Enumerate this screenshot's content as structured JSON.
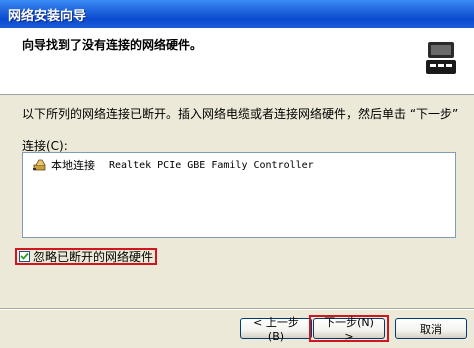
{
  "window": {
    "title": "网络安装向导"
  },
  "header": {
    "heading": "向导找到了没有连接的网络硬件。",
    "icon": "wizard-network-icon"
  },
  "body": {
    "instruction": "以下所列的网络连接已断开。插入网络电缆或者连接网络硬件，然后单击 “下一步”",
    "connections_label": "连接(C):",
    "connections": [
      {
        "name": "本地连接",
        "device": "Realtek PCIe GBE Family Controller",
        "icon": "network-connection-icon"
      }
    ],
    "ignore_checkbox": {
      "label": "忽略已断开的网络硬件",
      "checked": true
    }
  },
  "footer": {
    "back_label": "< 上一步(B)",
    "next_label": "下一步(N) >",
    "cancel_label": "取消"
  },
  "colors": {
    "titlebar": "#0A4BD1",
    "highlight": "#D0161E",
    "dialog_bg": "#ECE9D8"
  }
}
